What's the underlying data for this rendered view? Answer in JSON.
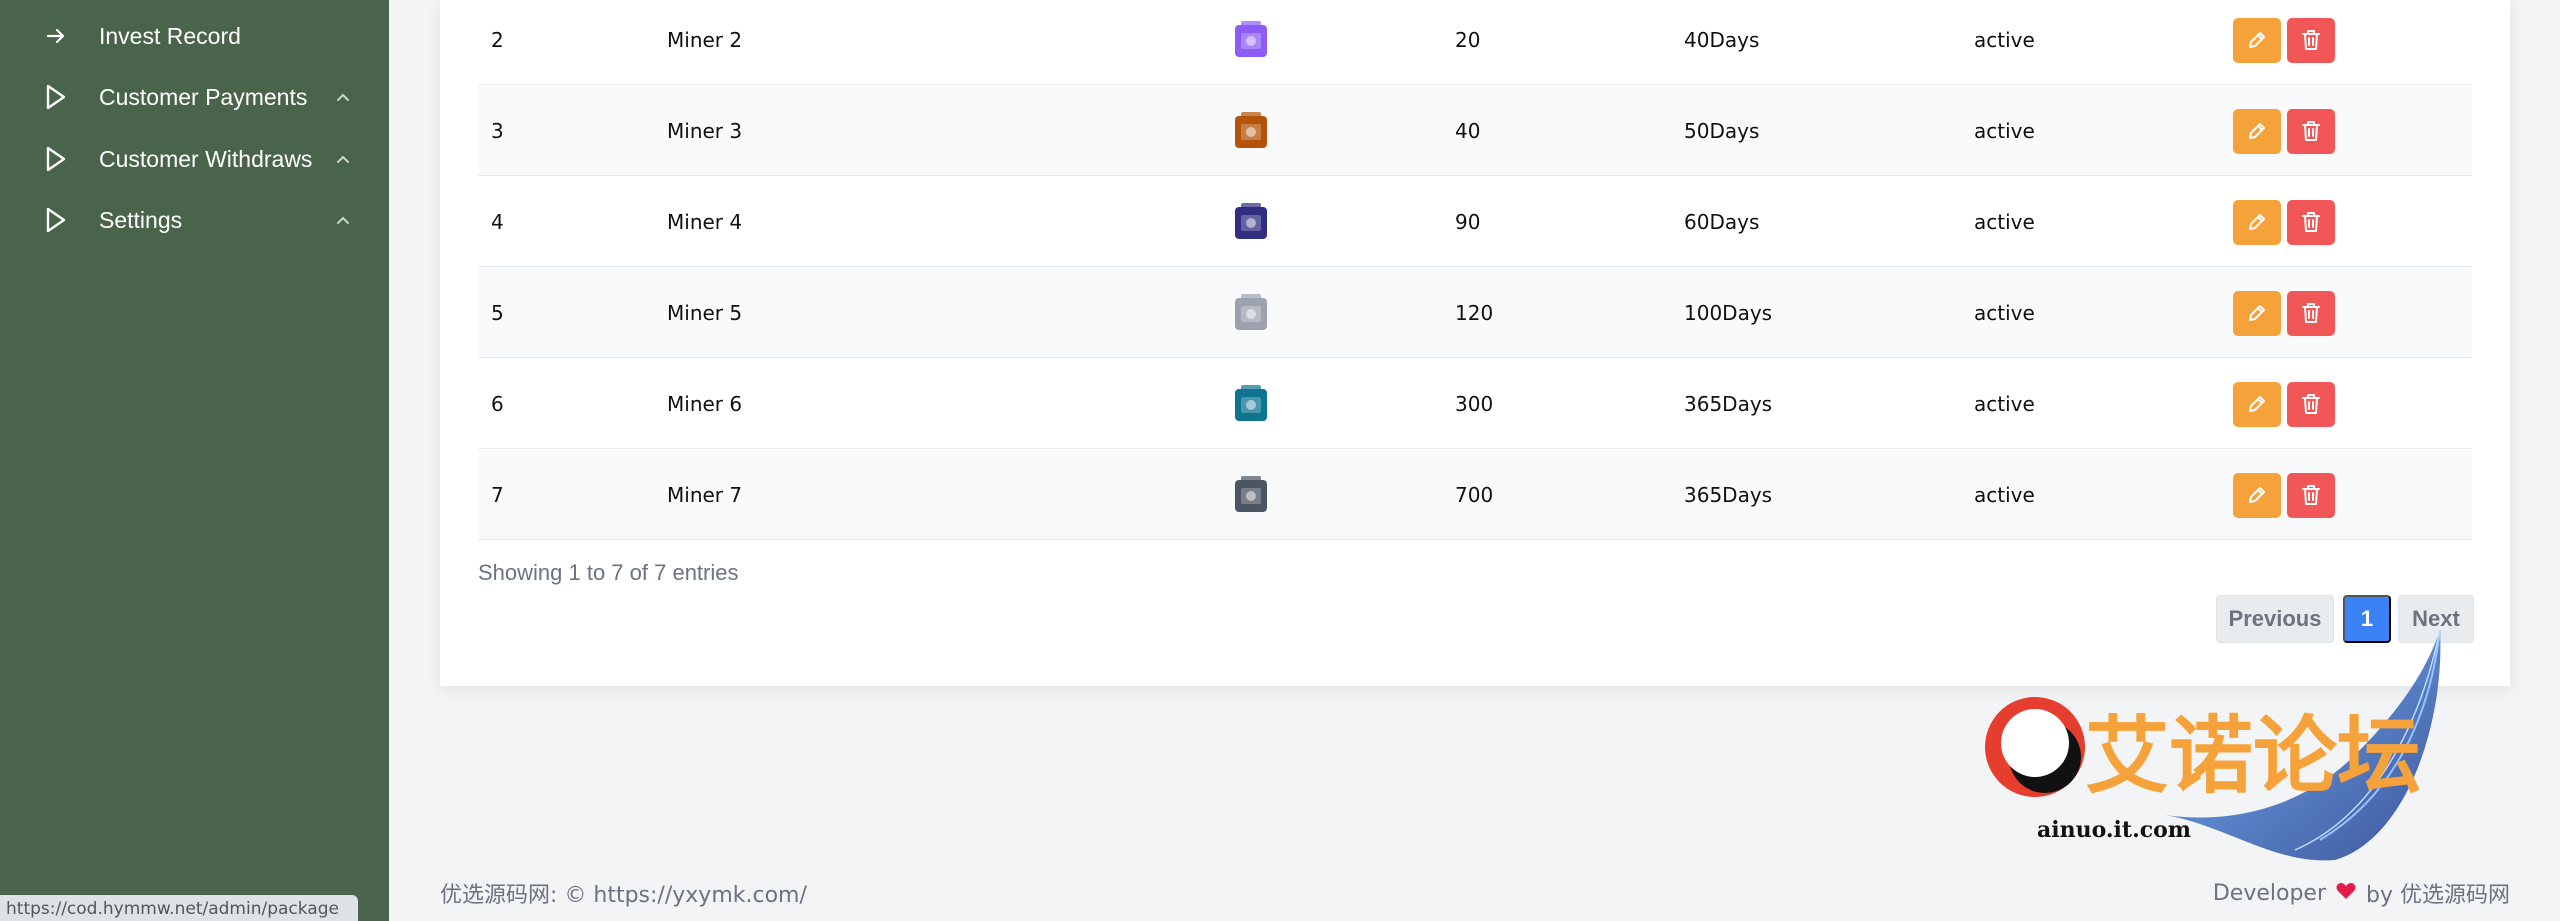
{
  "sidebar": {
    "items": [
      {
        "label": "Invest Record",
        "icon": "arrow-right-icon"
      },
      {
        "label": "Customer Payments",
        "icon": "play-outline-icon"
      },
      {
        "label": "Customer Withdraws",
        "icon": "play-outline-icon"
      },
      {
        "label": "Settings",
        "icon": "play-outline-icon"
      }
    ],
    "status_url": "https://cod.hymmw.net/admin/package"
  },
  "table": {
    "rows": [
      {
        "id": "2",
        "name": "Miner 2",
        "price": "20",
        "duration": "40Days",
        "status": "active",
        "image_color": "#8b5cf6"
      },
      {
        "id": "3",
        "name": "Miner 3",
        "price": "40",
        "duration": "50Days",
        "status": "active",
        "image_color": "#b45309"
      },
      {
        "id": "4",
        "name": "Miner 4",
        "price": "90",
        "duration": "60Days",
        "status": "active",
        "image_color": "#312e81"
      },
      {
        "id": "5",
        "name": "Miner 5",
        "price": "120",
        "duration": "100Days",
        "status": "active",
        "image_color": "#9ca3af"
      },
      {
        "id": "6",
        "name": "Miner 6",
        "price": "300",
        "duration": "365Days",
        "status": "active",
        "image_color": "#0e7490"
      },
      {
        "id": "7",
        "name": "Miner 7",
        "price": "700",
        "duration": "365Days",
        "status": "active",
        "image_color": "#4b5563"
      }
    ],
    "entries_text": "Showing 1 to 7 of 7 entries"
  },
  "pagination": {
    "previous": "Previous",
    "current": "1",
    "next": "Next"
  },
  "footer": {
    "left": "优选源码网: © https://yxymk.com/",
    "developer": "Developer",
    "by": "by 优选源码网"
  },
  "watermark": {
    "title": "艾诺论坛",
    "url": "ainuo.it.com"
  },
  "colors": {
    "sidebar_bg": "#4a634b",
    "edit_button": "#f6a23a",
    "delete_button": "#f25757",
    "page_active": "#3b82f6",
    "heart": "#e11d48"
  }
}
